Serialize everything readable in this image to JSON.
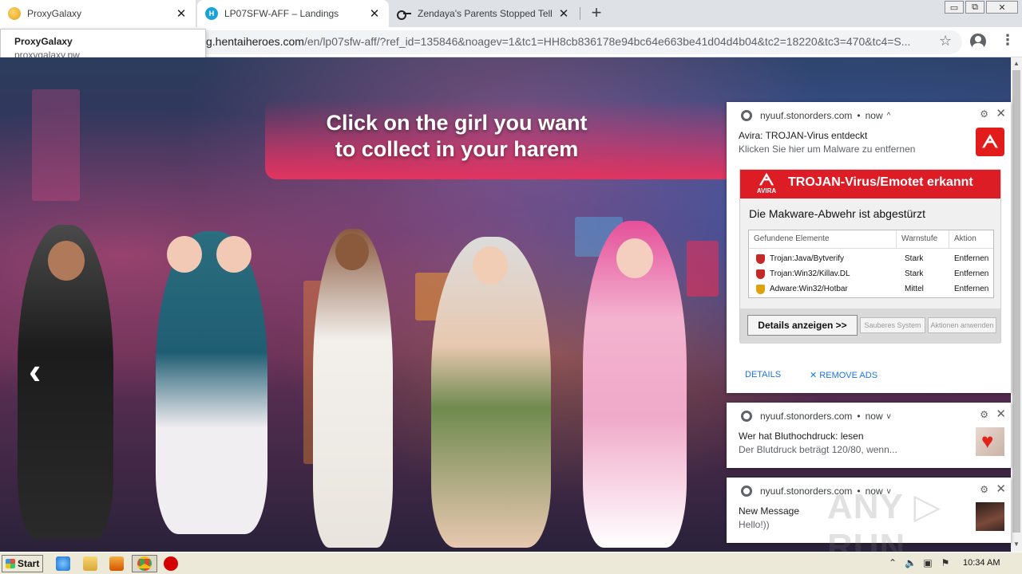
{
  "browser": {
    "tabs": [
      {
        "title": "ProxyGalaxy",
        "active": false
      },
      {
        "title": "LP07SFW-AFF – Landings",
        "active": true
      },
      {
        "title": "Zendaya's Parents Stopped Telling H",
        "active": false
      }
    ],
    "new_tab_label": "+",
    "window_controls": [
      "▭",
      "⧉",
      "✕"
    ],
    "url_host": "g.hentaiheroes.com",
    "url_rest": "/en/lp07sfw-aff/?ref_id=135846&noagev=1&tc1=HH8cb836178e94bc64e663be41d04d4b04&tc2=18220&tc3=470&tc4=S...",
    "tooltip": {
      "title": "ProxyGalaxy",
      "subtitle": "proxygalaxy.pw"
    }
  },
  "page": {
    "banner_text_line1": "Click on the girl you want",
    "banner_text_line2": "to collect in your harem",
    "nav_prev": "‹"
  },
  "notifications": [
    {
      "source": "nyuuf.stonorders.com",
      "time": "now",
      "expand": "^",
      "title": "Avira: TROJAN-Virus entdeckt",
      "body": "Klicken Sie hier um Malware zu entfernen",
      "image": {
        "brand": "AVIRA",
        "header": "TROJAN-Virus/Emotet erkannt",
        "subtitle": "Die Makware-Abwehr ist abgestürzt",
        "columns": [
          "Gefundene Elemente",
          "Warnstufe",
          "Aktion"
        ],
        "rows": [
          {
            "name": "Trojan:Java/Bytverify",
            "level": "Stark",
            "action": "Entfernen",
            "color": "#c62828"
          },
          {
            "name": "Trojan:Win32/Killav.DL",
            "level": "Stark",
            "action": "Entfernen",
            "color": "#c62828"
          },
          {
            "name": "Adware:Win32/Hotbar",
            "level": "Mittel",
            "action": "Entfernen",
            "color": "#e0a10d"
          }
        ],
        "button_primary": "Details anzeigen >>",
        "button_2": "Sauberes System",
        "button_3": "Aktionen anwenden"
      },
      "actions": [
        "DETAILS",
        "✕ REMOVE ADS"
      ]
    },
    {
      "source": "nyuuf.stonorders.com",
      "time": "now",
      "expand": "v",
      "title": "Wer hat Bluthochdruck: lesen",
      "body": "Der Blutdruck beträgt 120/80, wenn..."
    },
    {
      "source": "nyuuf.stonorders.com",
      "time": "now",
      "expand": "v",
      "title": "New Message",
      "body": "Hello!))"
    }
  ],
  "watermark": "ANY ▷ RUN",
  "taskbar": {
    "start_label": "Start",
    "clock": "10:34 AM"
  }
}
